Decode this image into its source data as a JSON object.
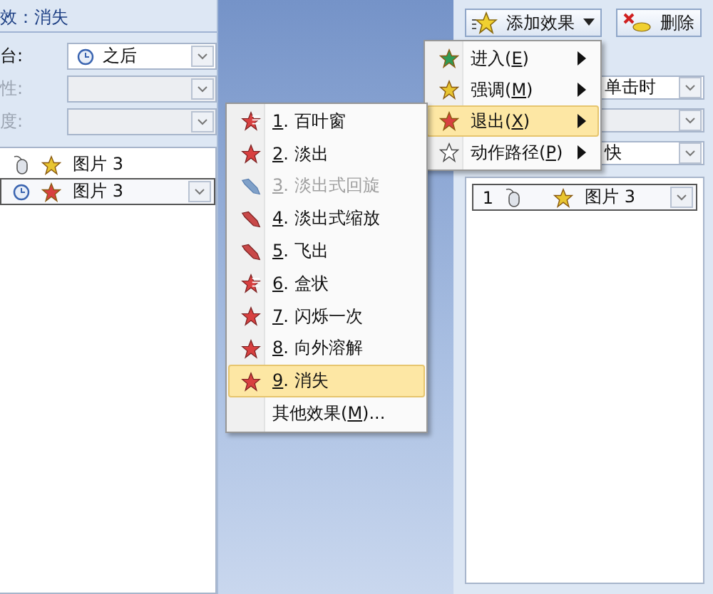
{
  "left_pane": {
    "header": "效：消失",
    "fields": [
      {
        "label": "台:",
        "value": "之后",
        "kind": "clock",
        "disabled": false
      },
      {
        "label": "性:",
        "disabled": true
      },
      {
        "label": "度:",
        "disabled": true
      }
    ],
    "list": [
      {
        "icons": [
          {
            "kind": "mouse"
          },
          {
            "kind": "emphasis"
          }
        ],
        "label": "图片 3",
        "selected": false
      },
      {
        "icons": [
          {
            "kind": "clock"
          },
          {
            "kind": "exit"
          }
        ],
        "label": "图片 3",
        "selected": true
      }
    ]
  },
  "right_pane": {
    "add_button": "添加效果",
    "delete_button": "删除",
    "fields": [
      {
        "value": "单击时",
        "disabled": false
      },
      {
        "disabled": true
      },
      {
        "value": "快",
        "disabled": false
      }
    ],
    "list": [
      {
        "number": "1",
        "icons": [
          {
            "kind": "mouse"
          },
          {
            "kind": "emphasis"
          }
        ],
        "label": "图片 3",
        "selected": true
      }
    ]
  },
  "effect_menu": [
    {
      "kind": "entrance",
      "before": "进入(",
      "key": "E",
      "after": ")",
      "selected": false
    },
    {
      "kind": "emphasis",
      "before": "强调(",
      "key": "M",
      "after": ")",
      "selected": false
    },
    {
      "kind": "exit",
      "before": "退出(",
      "key": "X",
      "after": ")",
      "selected": true
    },
    {
      "kind": "path",
      "before": "动作路径(",
      "key": "P",
      "after": ")",
      "selected": false
    }
  ],
  "exit_submenu": [
    {
      "key": "1",
      "rest": ". 百叶窗",
      "kind": "blinds",
      "disabled": false,
      "selected": false
    },
    {
      "key": "2",
      "rest": ". 淡出",
      "kind": "burst",
      "disabled": false,
      "selected": false
    },
    {
      "key": "3",
      "rest": ". 淡出式回旋",
      "kind": "fly",
      "disabled": true,
      "selected": false
    },
    {
      "key": "4",
      "rest": ". 淡出式缩放",
      "kind": "fly",
      "disabled": false,
      "selected": false
    },
    {
      "key": "5",
      "rest": ". 飞出",
      "kind": "fly",
      "disabled": false,
      "selected": false
    },
    {
      "key": "6",
      "rest": ". 盒状",
      "kind": "blinds",
      "disabled": false,
      "selected": false
    },
    {
      "key": "7",
      "rest": ". 闪烁一次",
      "kind": "burst",
      "disabled": false,
      "selected": false
    },
    {
      "key": "8",
      "rest": ". 向外溶解",
      "kind": "burst",
      "disabled": false,
      "selected": false
    },
    {
      "key": "9",
      "rest": ". 消失",
      "kind": "burst",
      "disabled": false,
      "selected": true
    },
    {
      "before": "其他效果(",
      "key": "M",
      "after": ")...",
      "disabled": false,
      "selected": false
    }
  ]
}
